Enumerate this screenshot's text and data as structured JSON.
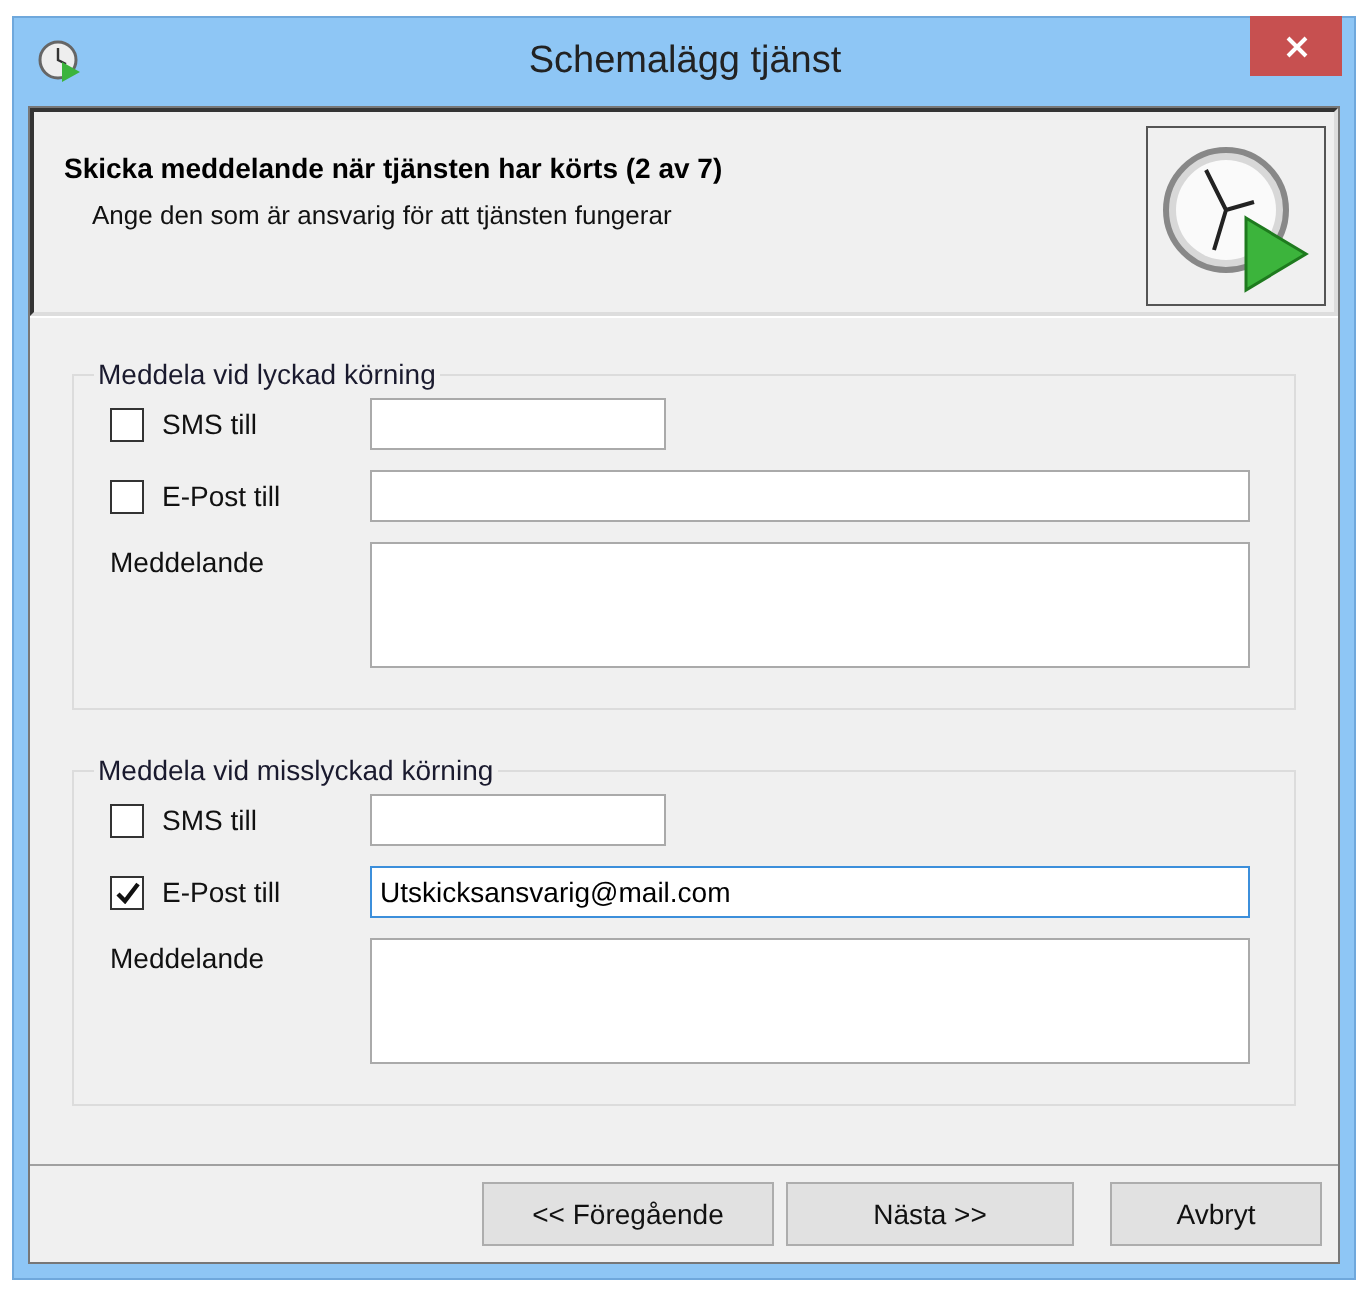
{
  "window": {
    "title": "Schemalägg tjänst"
  },
  "header": {
    "title": "Skicka meddelande när tjänsten har körts (2 av 7)",
    "subtitle": "Ange den som är ansvarig för att tjänsten fungerar"
  },
  "groups": [
    {
      "title": "Meddela vid lyckad körning",
      "sms": {
        "label": "SMS till",
        "checked": false
      },
      "email": {
        "label": "E-Post till",
        "checked": false
      },
      "message": {
        "label": "Meddelande"
      }
    },
    {
      "title": "Meddela vid misslyckad körning",
      "sms": {
        "label": "SMS till",
        "checked": false
      },
      "email": {
        "label": "E-Post till",
        "checked": true,
        "value": "Utskicksansvarig@mail.com",
        "focused": true
      },
      "message": {
        "label": "Meddelande"
      }
    }
  ],
  "buttons": [
    "<< Föregående",
    "Nästa >>",
    "Avbryt"
  ]
}
